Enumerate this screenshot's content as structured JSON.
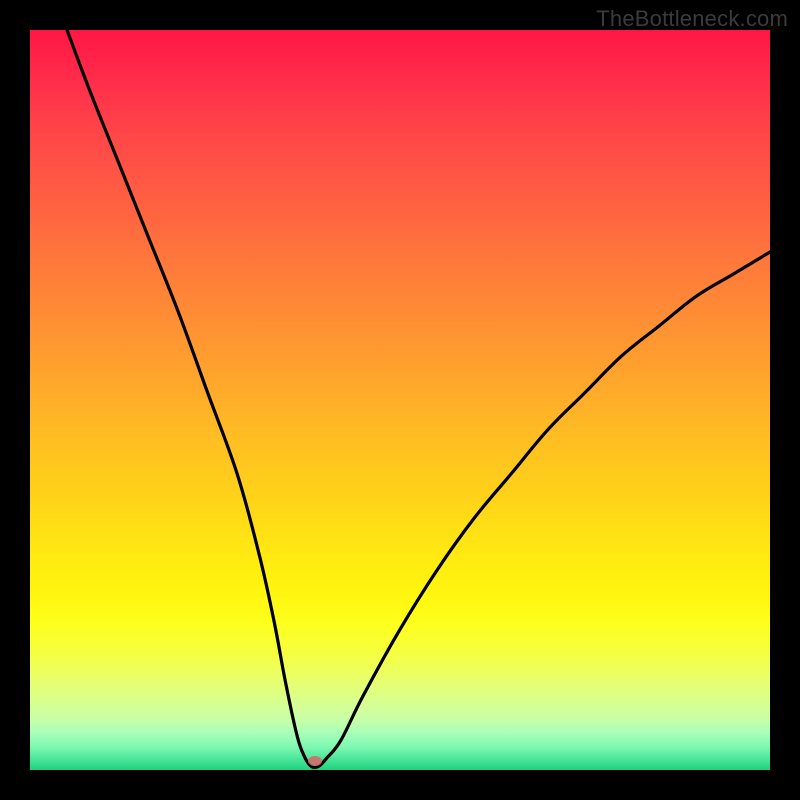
{
  "watermark": "TheBottleneck.com",
  "chart_data": {
    "type": "line",
    "title": "",
    "xlabel": "",
    "ylabel": "",
    "xlim": [
      0,
      100
    ],
    "ylim": [
      0,
      100
    ],
    "grid": false,
    "series": [
      {
        "name": "bottleneck-curve",
        "x": [
          5,
          8,
          12,
          16,
          20,
          24,
          28,
          31,
          33,
          34.5,
          36,
          37,
          38,
          39,
          40,
          42,
          45,
          50,
          55,
          60,
          65,
          70,
          75,
          80,
          85,
          90,
          95,
          100
        ],
        "y": [
          100,
          92,
          82,
          72,
          62,
          51,
          40,
          29,
          20,
          12,
          5,
          2,
          0.5,
          0.5,
          1.5,
          4,
          10,
          19,
          27,
          34,
          40,
          46,
          51,
          56,
          60,
          64,
          67,
          70
        ]
      }
    ],
    "marker": {
      "x": 38.5,
      "y": 1.2
    },
    "background_gradient": {
      "top": "#ff1744",
      "middle": "#ffe400",
      "bottom": "#1ed27e"
    }
  }
}
